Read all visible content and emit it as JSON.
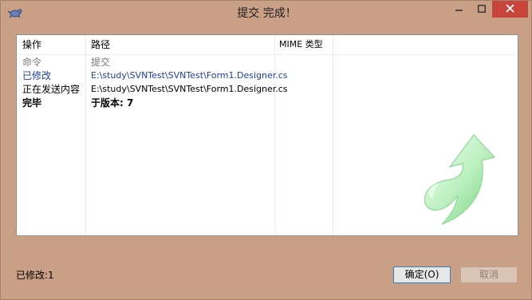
{
  "window": {
    "title": "提交 完成！",
    "app_icon": "tortoise-svn-icon",
    "controls": {
      "minimize": "minimize-icon",
      "maximize": "maximize-icon",
      "close": "close-icon"
    }
  },
  "table": {
    "columns": [
      "操作",
      "路径",
      "MIME 类型"
    ],
    "rows": [
      {
        "action": "命令",
        "path": "提交",
        "mime": "",
        "style": "gray"
      },
      {
        "action": "已修改",
        "path": "E:\\study\\SVNTest\\SVNTest\\Form1.Designer.cs",
        "mime": "",
        "style": "blue"
      },
      {
        "action": "正在发送内容",
        "path": "E:\\study\\SVNTest\\SVNTest\\Form1.Designer.cs",
        "mime": "",
        "style": "black"
      },
      {
        "action": "完毕",
        "path": "于版本: 7",
        "mime": "",
        "style": "bold"
      }
    ],
    "decoration_icon": "curved-green-arrow-icon"
  },
  "status": {
    "text": "已修改:1"
  },
  "buttons": {
    "ok": "确定(O)",
    "cancel": "取消"
  },
  "colors": {
    "window_bg": "#c99f85",
    "close_button": "#c7453b",
    "modified_text": "#1d3f9a",
    "arrow_green": "#7fd88a"
  }
}
